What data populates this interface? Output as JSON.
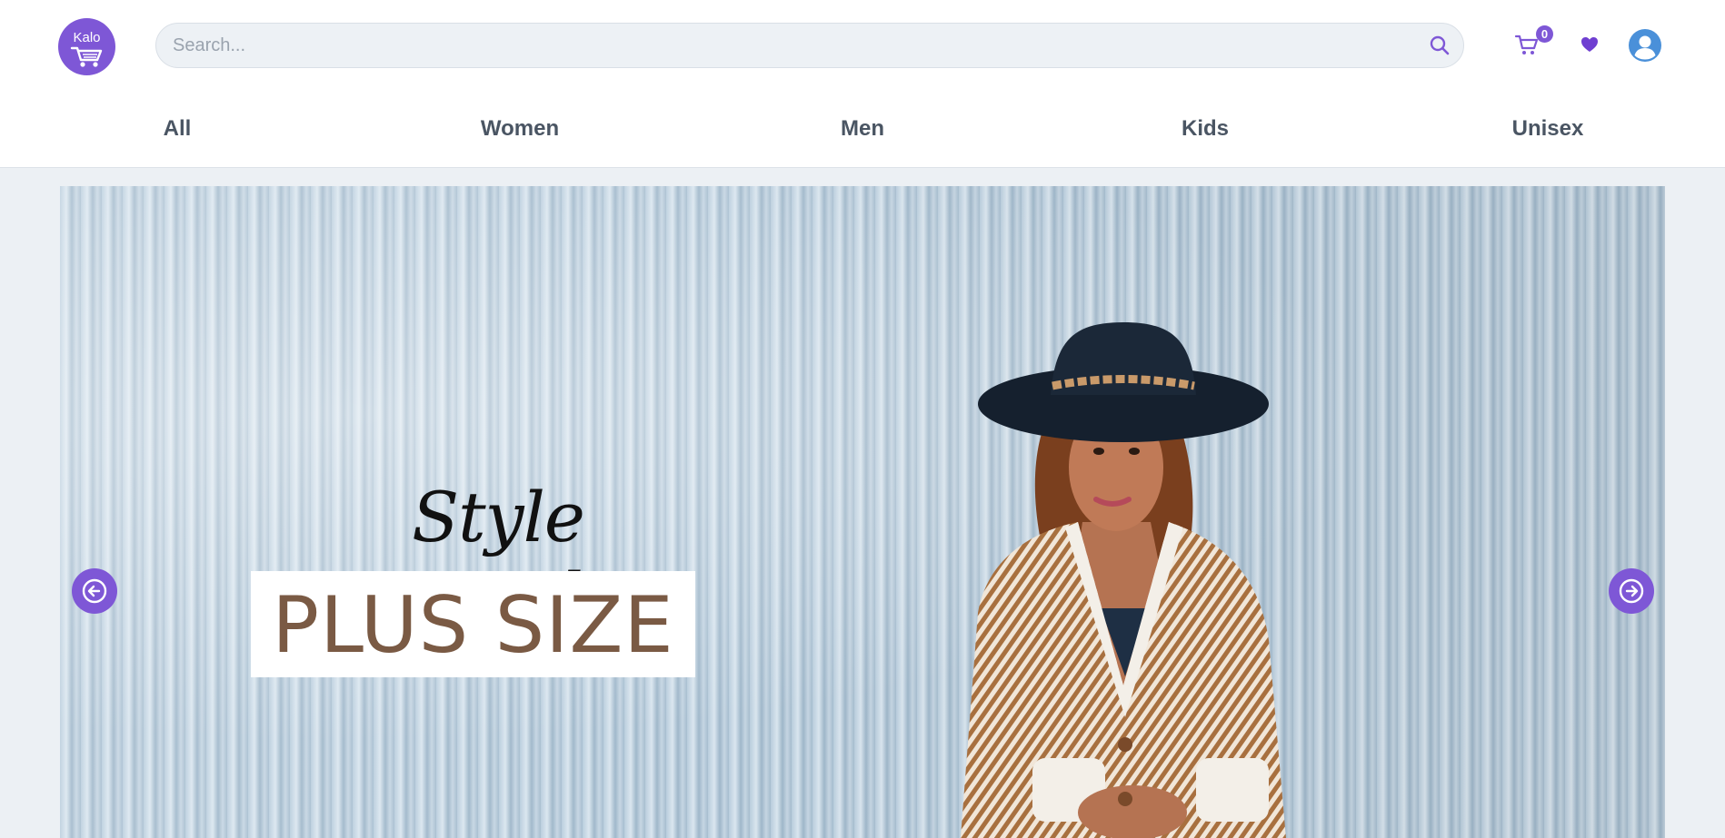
{
  "header": {
    "logo_text": "Kalo",
    "search_placeholder": "Search...",
    "cart_count": "0"
  },
  "nav": {
    "items": [
      {
        "label": "All"
      },
      {
        "label": "Women"
      },
      {
        "label": "Men"
      },
      {
        "label": "Kids"
      },
      {
        "label": "Unisex"
      }
    ]
  },
  "hero": {
    "script_title": "Style Watch",
    "headline": "PLUS SIZE"
  },
  "icons": {
    "search": "search-icon",
    "cart": "cart-icon",
    "wishlist": "heart-icon",
    "account": "user-icon",
    "prev": "arrow-left-circle-icon",
    "next": "arrow-right-circle-icon"
  },
  "colors": {
    "accent": "#7e57d6",
    "nav_text": "#4a5563",
    "user_avatar": "#4a90d9",
    "headline": "#7a5a44"
  }
}
